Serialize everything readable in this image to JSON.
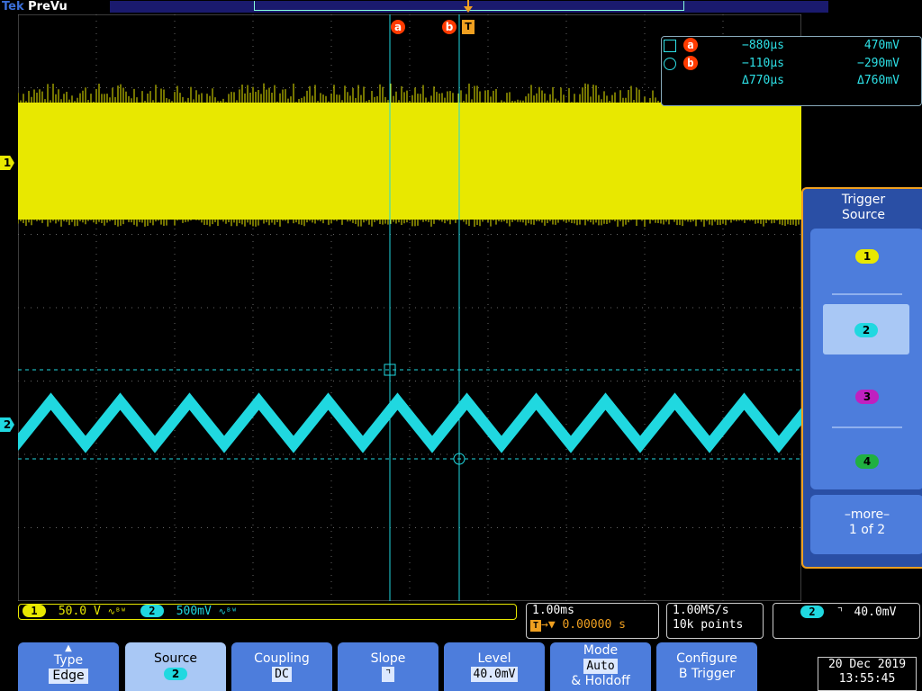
{
  "app": {
    "brand": "Tek",
    "mode": "PreVu"
  },
  "colors": {
    "ch1": "#e8e800",
    "ch2": "#20d8e0",
    "ch3": "#c020c0",
    "ch4": "#20b040",
    "cursor": "#ff3b00",
    "menu": "#4d7ddc",
    "accent": "#f0a020"
  },
  "cursors": {
    "a_label": "a",
    "b_label": "b",
    "trigger_label": "T",
    "readout": {
      "a_time": "−880µs",
      "a_volt": "470mV",
      "b_time": "−110µs",
      "b_volt": "−290mV",
      "delta_time": "Δ770µs",
      "delta_volt": "Δ760mV"
    }
  },
  "channels": {
    "ch1_marker": "1",
    "ch2_marker": "2",
    "ch1_scale": "50.0 V",
    "ch2_scale": "500mV",
    "bw_symbol": "∿ᴮᵂ"
  },
  "timebase": {
    "scale": "1.00ms",
    "trigger_pos": "0.00000 s",
    "sample_rate": "1.00MS/s",
    "record_length": "10k points"
  },
  "trigger_status": {
    "channel": "2",
    "slope_icon": "⌝",
    "level": "40.0mV"
  },
  "side_menu": {
    "title_line1": "Trigger",
    "title_line2": "Source",
    "sources": [
      "1",
      "2",
      "3",
      "4"
    ],
    "selected": "2",
    "more_line1": "–more–",
    "more_line2": "1 of 2"
  },
  "bottom_menu": [
    {
      "label": "Type",
      "value": "Edge"
    },
    {
      "label": "Source",
      "value": "2"
    },
    {
      "label": "Coupling",
      "value": "DC"
    },
    {
      "label": "Slope",
      "value": "⌝"
    },
    {
      "label": "Level",
      "value": "40.0mV"
    },
    {
      "label": "Mode",
      "value": "Auto",
      "extra": "& Holdoff"
    },
    {
      "label": "Configure",
      "value": "B Trigger"
    }
  ],
  "clock": {
    "date": "20 Dec 2019",
    "time": "13:55:45"
  }
}
